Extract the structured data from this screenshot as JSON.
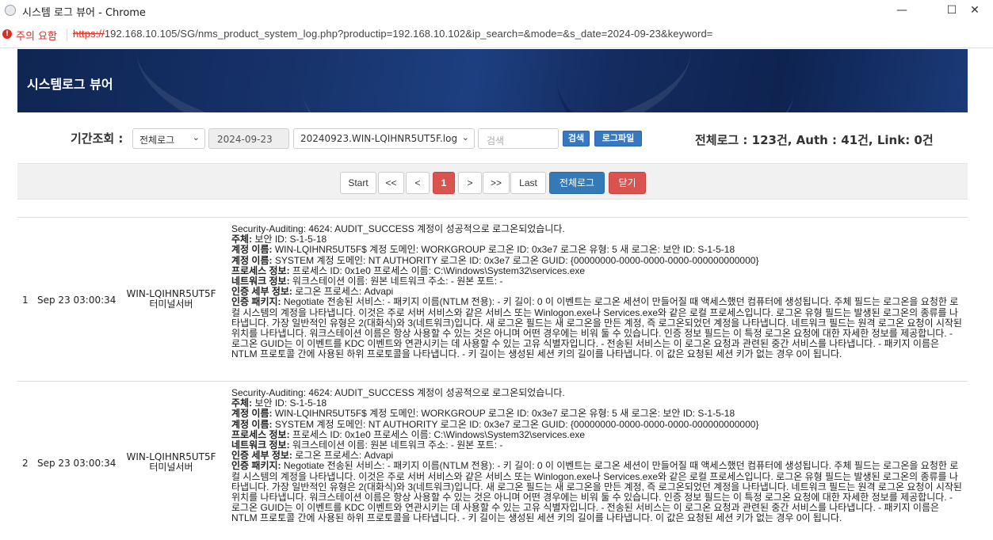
{
  "browser": {
    "title": "시스템 로그 뷰어 - Chrome",
    "security_label": "주의 요함",
    "url_protocol": "https://",
    "url_rest": "192.168.10.105/SG/nms_product_system_log.php?productip=192.168.10.102&ip_search=&mode=&s_date=2024-09-23&keyword=",
    "minimize": "—",
    "maximize": "☐",
    "close": "✕"
  },
  "header": {
    "title": "시스템로그 뷰어"
  },
  "search": {
    "period_label": "기간조회 :",
    "log_type": "전체로그",
    "date": "2024-09-23",
    "file": "20240923.WIN-LQIHNR5UT5F.log",
    "keyword_placeholder": "검색",
    "search_btn": "검색",
    "logfile_btn": "로그파일",
    "totals": "전체로그 : 123건, Auth : 41건, Link: 0건"
  },
  "pager": {
    "start": "Start",
    "prev_block": "<<",
    "prev": "<",
    "current": "1",
    "next": ">",
    "next_block": ">>",
    "last": "Last",
    "all_logs": "전체로그",
    "close": "닫기"
  },
  "logs": [
    {
      "no": "1",
      "time": "Sep 23 03:00:34",
      "host": "WIN-LQIHNR5UT5F",
      "host_sub": "터미널서버",
      "first_line": "Security-Auditing: 4624: AUDIT_SUCCESS 계정이 성공적으로 로그온되었습니다.",
      "fields": [
        {
          "label": "주체:",
          "value": " 보안 ID: S-1-5-18",
          "label2": "보안 ID"
        },
        {
          "label": "계정 이름:",
          "value": " WIN-LQIHNR5UT5F$ 계정 도메인: WORKGROUP 로그온 ID: 0x3e7 로그온 유형: 5 새 로그온: 보안 ID: S-1-5-18"
        },
        {
          "label": "계정 이름:",
          "value": " SYSTEM 계정 도메인: NT AUTHORITY 로그온 ID: 0x3e7 로그온 GUID: {00000000-0000-0000-0000-000000000000}"
        },
        {
          "label": "프로세스 정보:",
          "value": " 프로세스 ID: 0x1e0 프로세스 이름: C:\\Windows\\System32\\services.exe"
        },
        {
          "label": "네트워크 정보:",
          "value": " 워크스테이션 이름: 원본 네트워크 주소: - 원본 포트: -"
        },
        {
          "label": "인증 세부 정보:",
          "value": " 로그온 프로세스: Advapi"
        },
        {
          "label": "인증 패키지:",
          "value": " Negotiate 전송된 서비스: - 패키지 이름(NTLM 전용): - 키 길이: 0 이 이벤트는 로그온 세션이 만들어질 때 액세스했던 컴퓨터에 생성됩니다. 주체 필드는 로그온을 요청한 로컬 시스템의 계정을 나타냅니다. 이것은 주로 서버 서비스와 같은 서비스 또는 Winlogon.exe나 Services.exe와 같은 로컬 프로세스입니다. 로그온 유형 필드는 발생된 로그온의 종류를 나타냅니다. 가장 일반적인 유형은 2(대화식)와 3(네트워크)입니다. 새 로그온 필드는 새 로그온을 만든 계정, 즉 로그온되었던 계정을 나타냅니다. 네트워크 필드는 원격 로그온 요청이 시작된 위치를 나타냅니다. 워크스테이션 이름은 항상 사용할 수 있는 것은 아니며 어떤 경우에는 비워 둘 수 있습니다. 인증 정보 필드는 이 특정 로그온 요청에 대한 자세한 정보를 제공합니다. - 로그온 GUID는 이 이벤트를 KDC 이벤트와 연관시키는 데 사용할 수 있는 고유 식별자입니다. - 전송된 서비스는 이 로그온 요청과 관련된 중간 서비스를 나타냅니다. - 패키지 이름은 NTLM 프로토콜 간에 사용된 하위 프로토콜을 나타냅니다. - 키 길이는 생성된 세션 키의 길이를 나타냅니다. 이 값은 요청된 세션 키가 없는 경우 0이 됩니다."
        }
      ]
    },
    {
      "no": "2",
      "time": "Sep 23 03:00:34",
      "host": "WIN-LQIHNR5UT5F",
      "host_sub": "터미널서버",
      "first_line": "Security-Auditing: 4624: AUDIT_SUCCESS 계정이 성공적으로 로그온되었습니다.",
      "fields": [
        {
          "label": "주체:",
          "value": " 보안 ID: S-1-5-18"
        },
        {
          "label": "계정 이름:",
          "value": " WIN-LQIHNR5UT5F$ 계정 도메인: WORKGROUP 로그온 ID: 0x3e7 로그온 유형: 5 새 로그온: 보안 ID: S-1-5-18"
        },
        {
          "label": "계정 이름:",
          "value": " SYSTEM 계정 도메인: NT AUTHORITY 로그온 ID: 0x3e7 로그온 GUID: {00000000-0000-0000-0000-000000000000}"
        },
        {
          "label": "프로세스 정보:",
          "value": " 프로세스 ID: 0x1e0 프로세스 이름: C:\\Windows\\System32\\services.exe"
        },
        {
          "label": "네트워크 정보:",
          "value": " 워크스테이션 이름: 원본 네트워크 주소: - 원본 포트: -"
        },
        {
          "label": "인증 세부 정보:",
          "value": " 로그온 프로세스: Advapi"
        },
        {
          "label": "인증 패키지:",
          "value": " Negotiate 전송된 서비스: - 패키지 이름(NTLM 전용): - 키 길이: 0 이 이벤트는 로그온 세션이 만들어질 때 액세스했던 컴퓨터에 생성됩니다. 주체 필드는 로그온을 요청한 로컬 시스템의 계정을 나타냅니다. 이것은 주로 서버 서비스와 같은 서비스 또는 Winlogon.exe나 Services.exe와 같은 로컬 프로세스입니다. 로그온 유형 필드는 발생된 로그온의 종류를 나타냅니다. 가장 일반적인 유형은 2(대화식)와 3(네트워크)입니다. 새 로그온 필드는 새 로그온을 만든 계정, 즉 로그온되었던 계정을 나타냅니다. 네트워크 필드는 원격 로그온 요청이 시작된 위치를 나타냅니다. 워크스테이션 이름은 항상 사용할 수 있는 것은 아니며 어떤 경우에는 비워 둘 수 있습니다. 인증 정보 필드는 이 특정 로그온 요청에 대한 자세한 정보를 제공합니다. - 로그온 GUID는 이 이벤트를 KDC 이벤트와 연관시키는 데 사용할 수 있는 고유 식별자입니다. - 전송된 서비스는 이 로그온 요청과 관련된 중간 서비스를 나타냅니다. - 패키지 이름은 NTLM 프로토콜 간에 사용된 하위 프로토콜을 나타냅니다. - 키 길이는 생성된 세션 키의 길이를 나타냅니다. 이 값은 요청된 세션 키가 없는 경우 0이 됩니다."
        }
      ]
    }
  ]
}
